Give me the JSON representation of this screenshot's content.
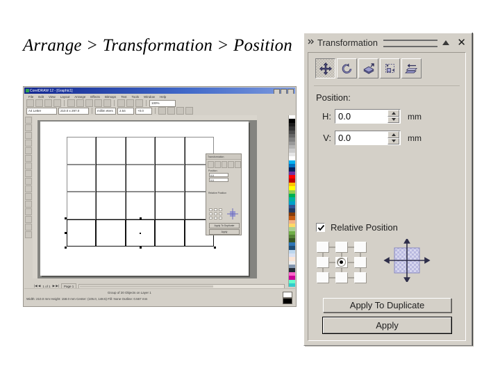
{
  "slide": {
    "title": "Arrange > Transformation > Position"
  },
  "docker": {
    "title": "Transformation",
    "grip_icon": "drag-handle-icon",
    "collapse_icon": "triangle-up-icon",
    "close_label": "✕",
    "tools": [
      {
        "name": "position-tool",
        "icon": "four-way-arrow-icon",
        "selected": true
      },
      {
        "name": "rotate-tool",
        "icon": "circular-arrow-icon",
        "selected": false
      },
      {
        "name": "scale-mirror-tool",
        "icon": "scale-mirror-icon",
        "selected": false
      },
      {
        "name": "size-tool",
        "icon": "size-box-icon",
        "selected": false
      },
      {
        "name": "skew-tool",
        "icon": "skew-icon",
        "selected": false
      }
    ],
    "section_label": "Position:",
    "fields": [
      {
        "name": "horizontal",
        "label": "H:",
        "value": "0.0",
        "unit": "mm"
      },
      {
        "name": "vertical",
        "label": "V:",
        "value": "0.0",
        "unit": "mm"
      }
    ],
    "relative_position": {
      "label": "Relative Position",
      "checked": true,
      "check_icon": "checkmark-icon"
    },
    "anchor_grid": {
      "name": "anchor-point-grid",
      "selected_index": 4,
      "rows": 3,
      "cols": 3
    },
    "preview": {
      "name": "transform-preview",
      "icon": "crosshair-arrows-icon"
    },
    "buttons": {
      "apply_to_duplicate": "Apply To Duplicate",
      "apply": "Apply"
    },
    "colors": {
      "face": "#d4d0c8",
      "shadow": "#808080",
      "highlight": "#ffffff",
      "preview_fill": "#9a9ad0"
    }
  },
  "app": {
    "title": "CorelDRAW 12 - [Graphic1]",
    "menus": [
      "File",
      "Edit",
      "View",
      "Layout",
      "Arrange",
      "Effects",
      "Bitmaps",
      "Text",
      "Tools",
      "Window",
      "Help"
    ],
    "zoom_value": "100%",
    "toolbar2": {
      "paper_field": "A4 Letter",
      "orientation_field": "210.0 x 297.0",
      "units_field": "millim eters",
      "nudge_field": "2.54",
      "duplicate_field": "+0.0"
    },
    "mini_docker": {
      "title": "Transformation",
      "section_label": "Position:",
      "h_label": "H:",
      "h_value": "0.0",
      "v_label": "V:",
      "v_value": "0.0",
      "unit": "mm",
      "relative_label": "Relative Position",
      "apply_dup": "Apply To Duplicate",
      "apply": "Apply"
    },
    "page_tab": "Page 1",
    "page_nav": "1 of 1",
    "status_line1": "Group of 20 Objects on Layer 1",
    "status_line2": "Width: 210.0 mm   Height: 158.0 mm   Center: (105.0, 148.5)   Fill: None   Outline: 0.567 mm",
    "canvas_object": {
      "name": "rectangle-grid",
      "cols": 5,
      "rows": 4
    }
  }
}
